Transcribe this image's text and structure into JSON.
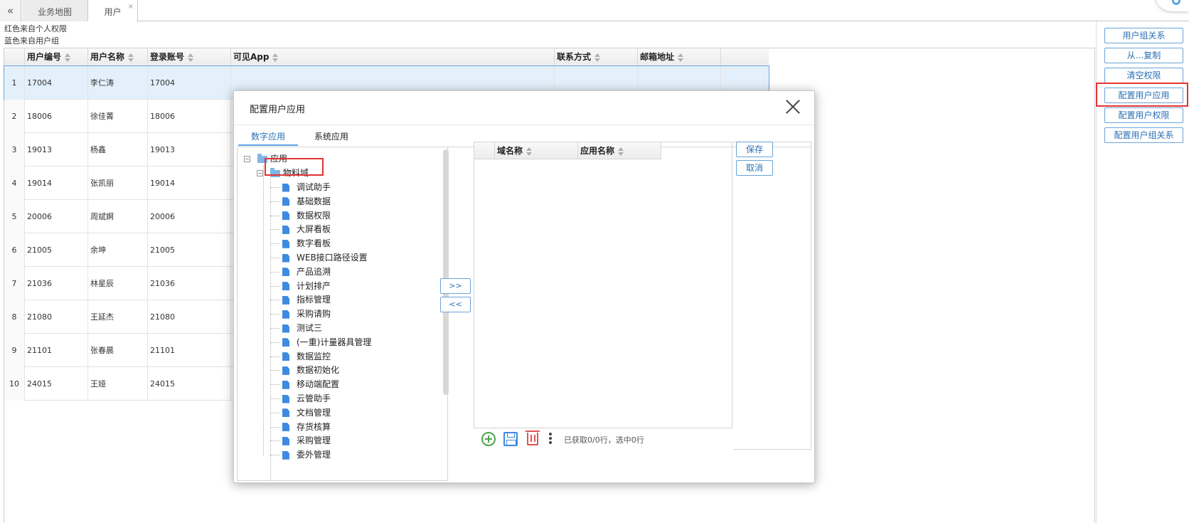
{
  "tabs": {
    "collapse_label": "«",
    "items": [
      {
        "label": "业务地图"
      },
      {
        "label": "用户",
        "close": "×"
      }
    ]
  },
  "legend": {
    "red_note": "红色来自个人权限",
    "blue_note": "蓝色来自用户组"
  },
  "grid": {
    "columns": [
      "用户编号",
      "用户名称",
      "登录账号",
      "可见App",
      "联系方式",
      "邮箱地址"
    ],
    "rows": [
      {
        "num": "1",
        "id": "17004",
        "name": "李仁涛",
        "account": "17004"
      },
      {
        "num": "2",
        "id": "18006",
        "name": "徐佳菁",
        "account": "18006"
      },
      {
        "num": "3",
        "id": "19013",
        "name": "杨鑫",
        "account": "19013"
      },
      {
        "num": "4",
        "id": "19014",
        "name": "张凯丽",
        "account": "19014"
      },
      {
        "num": "5",
        "id": "20006",
        "name": "周斌婀",
        "account": "20006"
      },
      {
        "num": "6",
        "id": "21005",
        "name": "余坤",
        "account": "21005"
      },
      {
        "num": "7",
        "id": "21036",
        "name": "林星辰",
        "account": "21036"
      },
      {
        "num": "8",
        "id": "21080",
        "name": "王延杰",
        "account": "21080"
      },
      {
        "num": "9",
        "id": "21101",
        "name": "张春晨",
        "account": "21101"
      },
      {
        "num": "10",
        "id": "24015",
        "name": "王娅",
        "account": "24015"
      }
    ]
  },
  "actions": [
    {
      "label": "用户组关系"
    },
    {
      "label": "从...复制"
    },
    {
      "label": "清空权限"
    },
    {
      "label": "配置用户应用"
    },
    {
      "label": "配置用户权限"
    },
    {
      "label": "配置用户组关系"
    }
  ],
  "modal": {
    "title": "配置用户应用",
    "tabs": [
      "数字应用",
      "系统应用"
    ],
    "tree": {
      "root": "应用",
      "domain": "物料域",
      "items": [
        "调试助手",
        "基础数据",
        "数据权限",
        "大屏看板",
        "数字看板",
        "WEB接口路径设置",
        "产品追溯",
        "计划排产",
        "指标管理",
        "采购请购",
        "测试三",
        "(一重)计量器具管理",
        "数据监控",
        "数据初始化",
        "移动端配置",
        "云管助手",
        "文档管理",
        "存货核算",
        "采购管理",
        "委外管理"
      ]
    },
    "transfer": {
      "add": ">>",
      "remove": "<<"
    },
    "grid_columns": [
      "域名称",
      "应用名称"
    ],
    "status": "已获取0/0行，选中0行",
    "save_label": "保存",
    "cancel_label": "取消"
  }
}
